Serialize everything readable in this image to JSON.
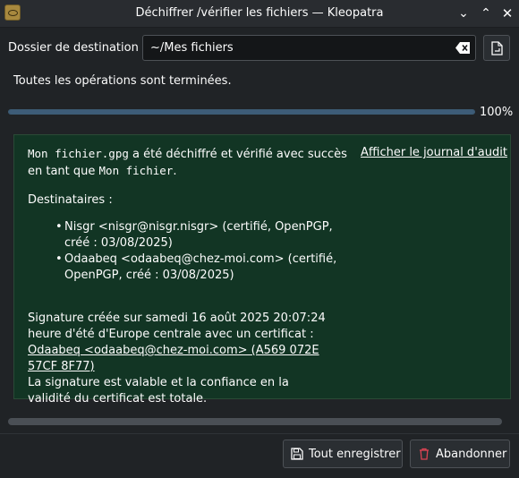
{
  "window": {
    "title": "Déchiffrer /vérifier les fichiers — Kleopatra",
    "controls": {
      "minimize": "⌄",
      "maximize": "⌃",
      "close": "✕"
    }
  },
  "destination": {
    "label": "Dossier de destination :",
    "value": "~/Mes fichiers",
    "clear_icon": "clear-text-icon",
    "browse_icon": "document-open-icon"
  },
  "status": {
    "text": "Toutes les opérations sont terminées.",
    "progress_percent": 100,
    "progress_label": "100%"
  },
  "result": {
    "file_name": "Mon fichier.gpg",
    "decrypted_text": " a été déchiffré et vérifié avec succès en tant que ",
    "output_name": "Mon fichier",
    "end_period": ".",
    "audit_link": "Afficher le journal d'audit",
    "recipients_label": "Destinataires :",
    "recipients": [
      "Nisgr <nisgr@nisgr.nisgr> (certifié, OpenPGP, créé : 03/08/2025)",
      "Odaabeq <odaabeq@chez-moi.com> (certifié, OpenPGP, créé : 03/08/2025)"
    ],
    "signature_prefix": "Signature créée sur samedi 16 août 2025 20:07:24 heure d'été d'Europe centrale avec un certificat : ",
    "signature_link": "Odaabeq <odaabeq@chez-moi.com> (A569 072E 57CF 8F77)",
    "signature_validity": "La signature est valable et la confiance en la validité du certificat est totale.",
    "background_color": "#123524"
  },
  "buttons": {
    "save_all": "Tout enregistrer",
    "save_icon": "document-save-icon",
    "abort": "Abandonner",
    "abort_icon": "trash-icon"
  }
}
